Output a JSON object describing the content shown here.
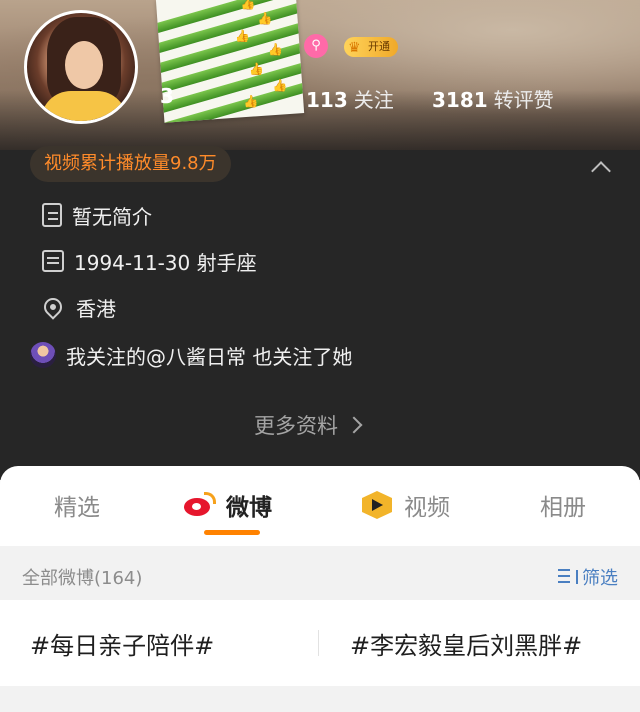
{
  "profile": {
    "stats": [
      {
        "num": "3",
        "label": ""
      },
      {
        "num": "113",
        "label": "关注"
      },
      {
        "num": "3181",
        "label": "转评赞"
      }
    ],
    "vip_label": "开通",
    "play_count": "视频累计播放量9.8万",
    "bio": "暂无简介",
    "birthday": "1994-11-30 射手座",
    "location": "香港",
    "mutual": "我关注的@八酱日常 也关注了她",
    "more_info": "更多资料"
  },
  "tabs": [
    {
      "label": "精选",
      "active": false
    },
    {
      "label": "微博",
      "active": true
    },
    {
      "label": "视频",
      "active": false
    },
    {
      "label": "相册",
      "active": false
    }
  ],
  "filter": {
    "count_label": "全部微博(164)",
    "filter_label": "筛选"
  },
  "topics": [
    "#每日亲子陪伴#",
    "#李宏毅皇后刘黑胖#"
  ],
  "colors": {
    "accent_orange": "#ff8200",
    "play_count": "#ff8b2a",
    "filter_blue": "#4a7fc1",
    "dark_panel": "#262626",
    "weibo_red": "#e6162d"
  }
}
